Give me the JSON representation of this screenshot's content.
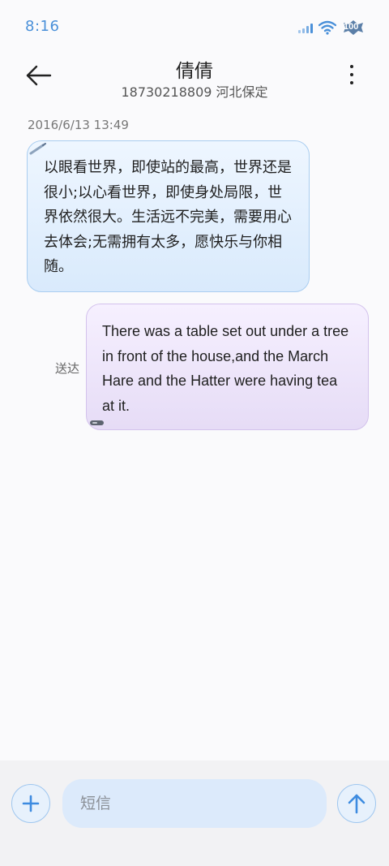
{
  "status_bar": {
    "time": "8:16",
    "icons": [
      "signal-icon",
      "wifi-icon",
      "battery-icon"
    ],
    "battery_level": "100"
  },
  "header": {
    "back_icon": "arrow-left-icon",
    "contact_name": "倩倩",
    "contact_sub": "18730218809 河北保定",
    "more_icon": "more-vertical-icon"
  },
  "messages": [
    {
      "direction": "incoming",
      "timestamp": "2016/6/13 13:49",
      "text": "以眼看世界，即使站的最高，世界还是很小;以心看世界，即使身处局限，世界依然很大。生活远不完美，需要用心去体会;无需拥有太多，愿快乐与你相随。"
    },
    {
      "direction": "outgoing",
      "text": "There was a table set out under a tree in front of the house,and the March Hare and the Hatter were having tea at it.",
      "status": "送达"
    }
  ],
  "input_bar": {
    "add_icon": "plus-icon",
    "placeholder": "短信",
    "send_icon": "arrow-up-icon"
  },
  "colors": {
    "accent": "#4a90d9",
    "incoming_bubble": "#e3effc",
    "outgoing_bubble": "#ece4f8",
    "input_bg": "#dceafb"
  }
}
